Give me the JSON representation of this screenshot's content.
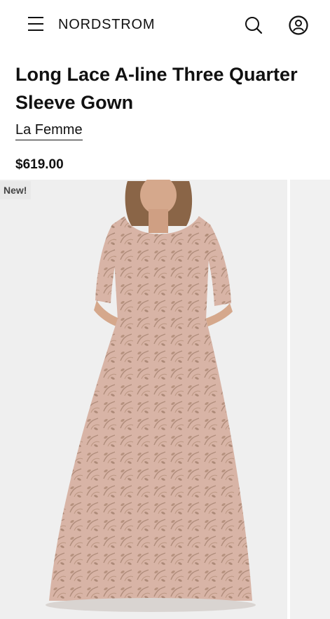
{
  "header": {
    "logo": "NORDSTROM",
    "menu_icon": "hamburger-menu-icon",
    "search_icon": "search-icon",
    "account_icon": "account-icon"
  },
  "product": {
    "title": "Long Lace A-line Three Quarter Sleeve Gown",
    "brand": "La Femme",
    "price": "$619.00",
    "badge": "New!"
  },
  "colors": {
    "gown": "#d8b4a6",
    "lace": "#a98674",
    "background": "#efefef"
  }
}
